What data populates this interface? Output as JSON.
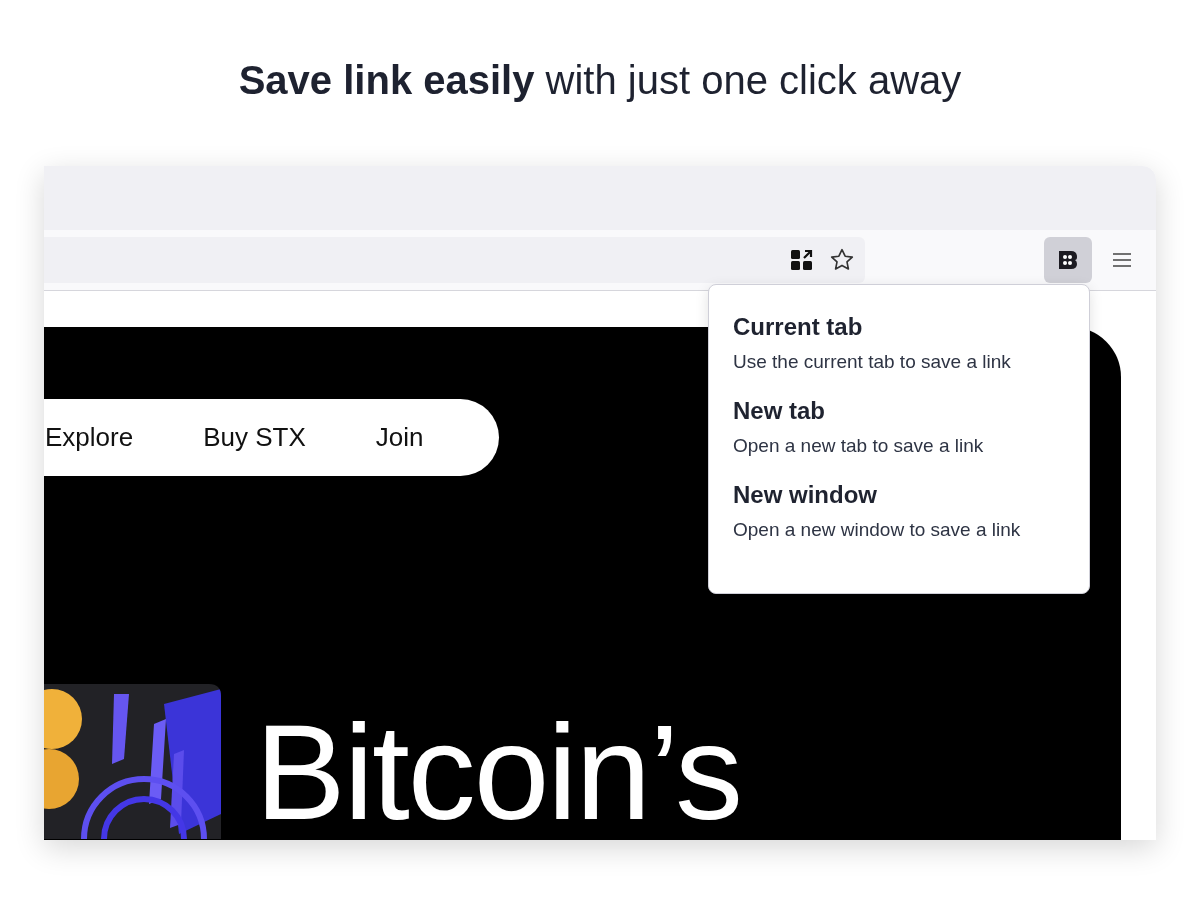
{
  "headline": "**Save link easily** with just one click away",
  "toolbar": {
    "extension_button": {
      "selected": true
    }
  },
  "menu": {
    "items": [
      {
        "title": "Current tab",
        "description": "Use the current tab to save a link"
      },
      {
        "title": "New tab",
        "description": "Open a new tab to save a link"
      },
      {
        "title": "New window",
        "description": "Open a new window to save a link"
      }
    ]
  },
  "page": {
    "nav": [
      "Explore",
      "Buy STX",
      "Join"
    ],
    "hero_title": "Bitcoin’s"
  }
}
